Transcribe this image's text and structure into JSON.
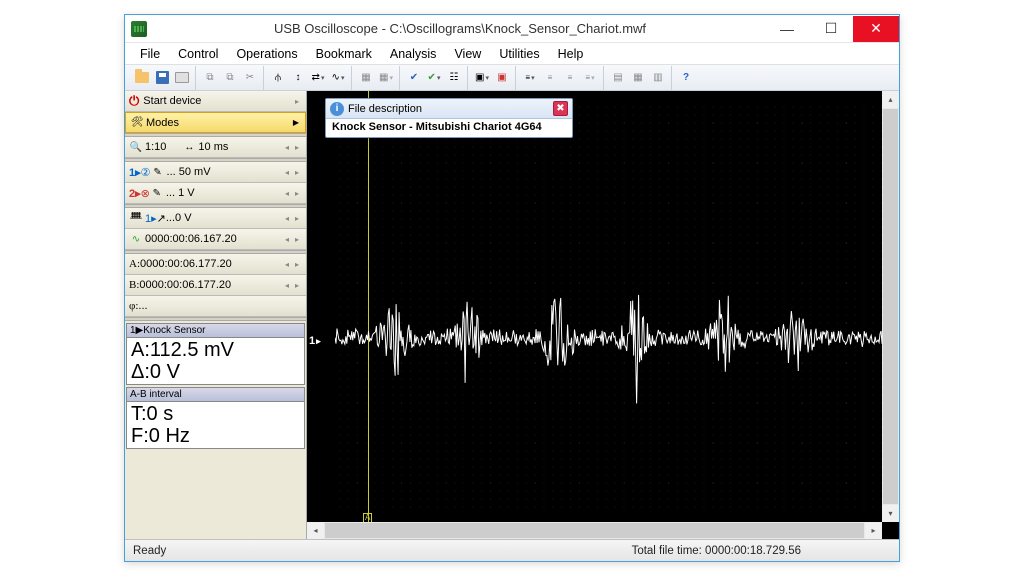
{
  "title": "USB Oscilloscope - C:\\Oscillograms\\Knock_Sensor_Chariot.mwf",
  "menu": [
    "File",
    "Control",
    "Operations",
    "Bookmark",
    "Analysis",
    "View",
    "Utilities",
    "Help"
  ],
  "sidebar": {
    "start": "Start device",
    "modes": "Modes",
    "zoom": "1:10",
    "timebase": "10 ms",
    "ch1": "... 50 mV",
    "ch2": "... 1 V",
    "trig": "...0 V",
    "tstamp": "0000:00:06.167.20",
    "cursorA": "0000:00:06.177.20",
    "cursorB": "0000:00:06.177.20",
    "phi": "...",
    "ch_marker": "1"
  },
  "measure": {
    "ch_head": "1▶Knock Sensor",
    "A": "A:112.5 mV",
    "D": "Δ:0 V",
    "interval_head": "A-B interval",
    "T": "T:0 s",
    "F": "F:0 Hz"
  },
  "tooltip": {
    "title": "File description",
    "body": "Knock Sensor - Mitsubishi Chariot 4G64"
  },
  "status": {
    "left": "Ready",
    "right": "Total file time: 0000:00:18.729.56"
  },
  "ab_label": "A\nB"
}
